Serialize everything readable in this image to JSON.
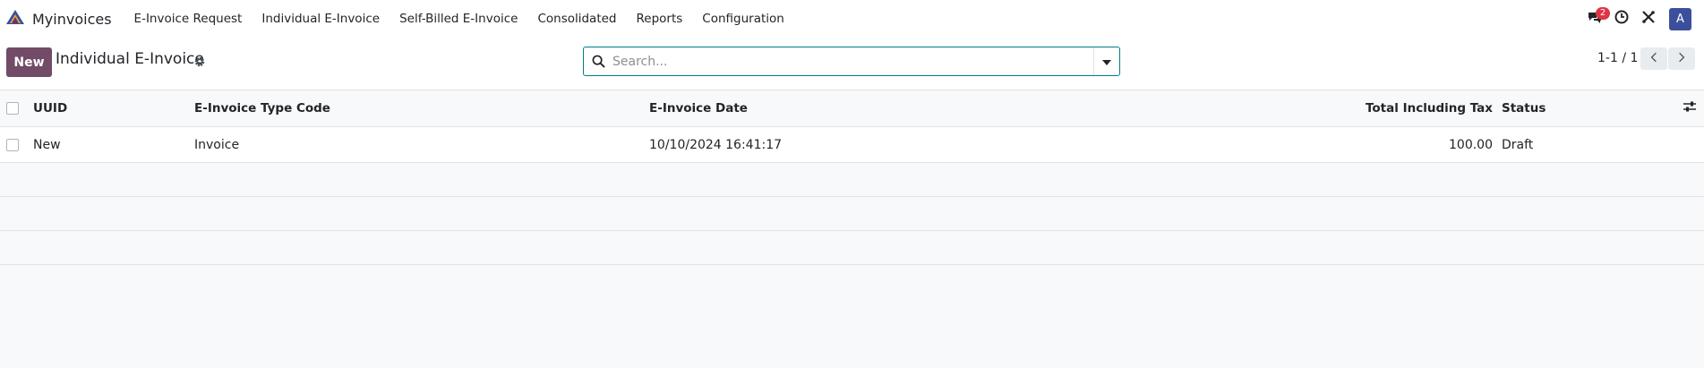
{
  "app": {
    "name": "Myinvoices",
    "menu": [
      "E-Invoice Request",
      "Individual E-Invoice",
      "Self-Billed E-Invoice",
      "Consolidated",
      "Reports",
      "Configuration"
    ],
    "messages_badge": "2",
    "user_initial": "A",
    "brand_color": "#714b67",
    "avatar_color": "#3b4f9c"
  },
  "control_panel": {
    "new_label": "New",
    "title": "Individual E-Invoice",
    "search_placeholder": "Search...",
    "pager": "1-1 / 1"
  },
  "table": {
    "columns": [
      "UUID",
      "E-Invoice Type Code",
      "E-Invoice Date",
      "Total Including Tax",
      "Status"
    ],
    "rows": [
      {
        "uuid": "New",
        "type_code": "Invoice",
        "date": "10/10/2024 16:41:17",
        "total": "100.00",
        "status": "Draft"
      }
    ]
  }
}
